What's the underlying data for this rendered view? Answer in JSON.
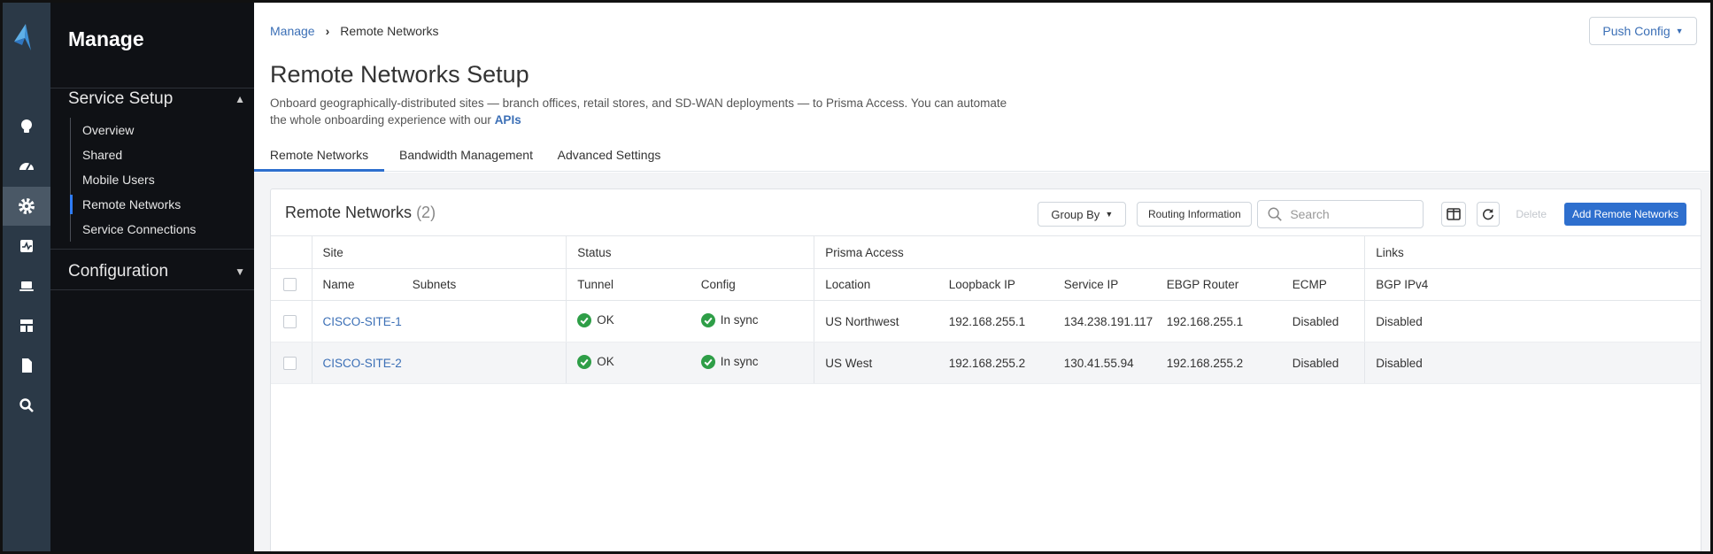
{
  "nav": {
    "title": "Manage",
    "sections": [
      {
        "label": "Service Setup",
        "expanded": true
      },
      {
        "label": "Configuration",
        "expanded": false
      }
    ],
    "items": [
      "Overview",
      "Shared",
      "Mobile Users",
      "Remote Networks",
      "Service Connections"
    ],
    "active_item": "Remote Networks"
  },
  "rail": {
    "icons": [
      "lightbulb-icon",
      "dashboard-icon",
      "gear-icon",
      "activity-icon",
      "laptop-icon",
      "layout-icon",
      "document-icon",
      "search-icon"
    ],
    "active_icon": "gear-icon"
  },
  "breadcrumb": {
    "root": "Manage",
    "current": "Remote Networks"
  },
  "push_config": {
    "label": "Push Config"
  },
  "page": {
    "title": "Remote Networks Setup",
    "description": "Onboard geographically-distributed sites — branch offices, retail stores, and SD-WAN deployments — to Prisma Access. You can automate the whole onboarding experience with our",
    "description_link": "APIs"
  },
  "tabs": [
    {
      "label": "Remote Networks",
      "active": true
    },
    {
      "label": "Bandwidth Management",
      "active": false
    },
    {
      "label": "Advanced Settings",
      "active": false
    }
  ],
  "card": {
    "title": "Remote Networks",
    "count": "(2)",
    "group_by": "Group By",
    "routing_info": "Routing Information",
    "search_placeholder": "Search",
    "delete": "Delete",
    "add": "Add Remote Networks"
  },
  "table": {
    "groups": [
      "Site",
      "Status",
      "Prisma Access",
      "Links"
    ],
    "columns": [
      "Name",
      "Subnets",
      "Tunnel",
      "Config",
      "Location",
      "Loopback IP",
      "Service IP",
      "EBGP Router",
      "ECMP",
      "BGP IPv4"
    ],
    "rows": [
      {
        "name": "CISCO-SITE-1",
        "subnets": "",
        "tunnel": "OK",
        "config": "In sync",
        "location": "US Northwest",
        "loopback_ip": "192.168.255.1",
        "service_ip": "134.238.191.117",
        "ebgp_router": "192.168.255.1",
        "ecmp": "Disabled",
        "bgp_ipv4": "Disabled"
      },
      {
        "name": "CISCO-SITE-2",
        "subnets": "",
        "tunnel": "OK",
        "config": "In sync",
        "location": "US West",
        "loopback_ip": "192.168.255.2",
        "service_ip": "130.41.55.94",
        "ebgp_router": "192.168.255.2",
        "ecmp": "Disabled",
        "bgp_ipv4": "Disabled"
      }
    ]
  },
  "colors": {
    "accent": "#2e6fce",
    "link": "#3b6fb6",
    "ok": "#2e9e47",
    "rail": "#2b3947",
    "nav": "#0f1115"
  }
}
